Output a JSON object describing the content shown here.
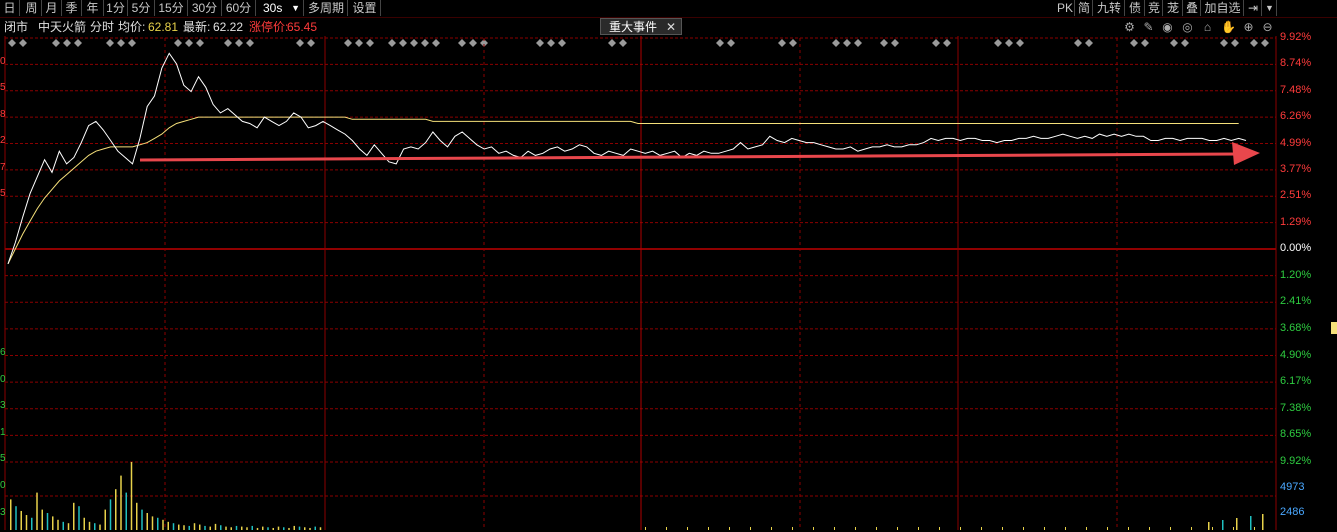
{
  "toolbar": {
    "periods": [
      "日",
      "周",
      "月",
      "季",
      "年",
      "1分",
      "5分",
      "15分",
      "30分",
      "60分"
    ],
    "interval": "30s",
    "multi_period": "多周期",
    "settings": "设置",
    "right_buttons": [
      "PK",
      "简",
      "九转",
      "债",
      "竞",
      "茏",
      "叠",
      "加自选"
    ]
  },
  "info": {
    "status": "闭市",
    "stock_name": "中天火箭",
    "mode": "分时",
    "avg_label": "均价:",
    "avg_value": "62.81",
    "latest_label": "最新:",
    "latest_value": "62.22",
    "limit_label": "涨停价:",
    "limit_value": "65.45",
    "event_tab": "重大事件"
  },
  "icons": [
    "settings-gear-icon",
    "brush-icon",
    "eye-icon",
    "eye-outline-icon",
    "basket-icon",
    "hand-icon",
    "zoom-in-icon",
    "zoom-out-icon"
  ],
  "axis_right": {
    "up": [
      "9.92%",
      "8.74%",
      "7.48%",
      "6.26%",
      "4.99%",
      "3.77%",
      "2.51%",
      "1.29%"
    ],
    "zero": "0.00%",
    "down": [
      "1.20%",
      "2.41%",
      "3.68%",
      "4.90%",
      "6.17%",
      "7.38%",
      "8.65%",
      "9.92%"
    ],
    "volume": [
      "4973",
      "2486"
    ]
  },
  "axis_left_partial": [
    "0",
    "5",
    "8",
    "2",
    "7",
    "5",
    "",
    "",
    "",
    "",
    "",
    "6",
    "0",
    "3",
    "1",
    "5",
    "0",
    "3"
  ],
  "colors": {
    "up": "#ff3b3b",
    "down": "#2ecc40",
    "zero": "#ffffff",
    "grid": "#8b0000",
    "price_line": "#ffffff",
    "avg_line": "#f5e07a",
    "arrow": "#e8474c",
    "volume_up": "#e8d24a",
    "volume_down": "#20c0c0"
  },
  "chart_data": {
    "type": "line",
    "y_unit": "percent change",
    "ylim": [
      -9.92,
      9.92
    ],
    "series": [
      {
        "values": [
          -0.7,
          0.3,
          1.5,
          2.6,
          3.4,
          4.2,
          3.6,
          4.6,
          4.0,
          4.3,
          5.0,
          5.8,
          6.0,
          5.6,
          5.1,
          4.6,
          4.3,
          4.0,
          5.2,
          6.7,
          7.2,
          8.5,
          9.2,
          8.7,
          7.7,
          7.4,
          8.1,
          7.6,
          6.8,
          6.4,
          6.6,
          6.3,
          6.0,
          5.9,
          5.7,
          6.2,
          6.0,
          5.8,
          6.0,
          6.4,
          6.2,
          5.7,
          5.8,
          6.0,
          5.8,
          5.6,
          5.4,
          5.1,
          4.7,
          4.4,
          4.9,
          4.5,
          4.1,
          4.0,
          4.7,
          4.8,
          4.7,
          5.0,
          5.5,
          5.1,
          4.8,
          5.3,
          5.5,
          5.2,
          4.9,
          4.7,
          4.8,
          4.5,
          4.6,
          4.4,
          4.3,
          4.6,
          4.4,
          4.5,
          4.7,
          4.8,
          4.6,
          4.7,
          4.9,
          4.8,
          4.5,
          4.4,
          4.6,
          4.5,
          4.4,
          4.7,
          4.6,
          4.5,
          4.6,
          4.4,
          4.5,
          4.6,
          4.3,
          4.5,
          4.4,
          4.6,
          4.5,
          4.5,
          4.6,
          4.7,
          5.0,
          4.7,
          4.8,
          4.9,
          5.3,
          5.1,
          5.0,
          5.2,
          5.1,
          5.0,
          5.0,
          4.9,
          4.8,
          4.7,
          4.7,
          4.8,
          4.6,
          4.7,
          4.8,
          4.8,
          4.9,
          4.8,
          4.8,
          4.9,
          4.9,
          5.0,
          5.2,
          5.1,
          5.2,
          5.2,
          5.1,
          5.2,
          5.2,
          5.1,
          5.1,
          5.0,
          5.1,
          5.1,
          5.2,
          5.2,
          5.3,
          5.2,
          5.2,
          5.3,
          5.4,
          5.3,
          5.2,
          5.3,
          5.2,
          5.4,
          5.3,
          5.4,
          5.3,
          5.4,
          5.3,
          5.3,
          5.1,
          5.1,
          5.2,
          5.2,
          5.1,
          5.2,
          5.2,
          5.2,
          5.1,
          5.1,
          5.2,
          5.1,
          5.2,
          5.1
        ]
      },
      {
        "values": [
          -0.7,
          0.0,
          0.7,
          1.3,
          1.9,
          2.4,
          2.8,
          3.2,
          3.5,
          3.8,
          4.1,
          4.4,
          4.6,
          4.7,
          4.8,
          4.8,
          4.8,
          4.8,
          4.9,
          5.0,
          5.2,
          5.4,
          5.7,
          5.9,
          6.0,
          6.1,
          6.2,
          6.2,
          6.2,
          6.2,
          6.2,
          6.2,
          6.2,
          6.2,
          6.2,
          6.2,
          6.2,
          6.2,
          6.2,
          6.2,
          6.2,
          6.2,
          6.2,
          6.2,
          6.2,
          6.2,
          6.2,
          6.1,
          6.1,
          6.1,
          6.1,
          6.1,
          6.1,
          6.1,
          6.1,
          6.1,
          6.1,
          6.1,
          6.0,
          6.0,
          6.0,
          6.0,
          6.0,
          6.0,
          6.0,
          6.0,
          6.0,
          6.0,
          6.0,
          6.0,
          6.0,
          6.0,
          6.0,
          6.0,
          6.0,
          6.0,
          6.0,
          6.0,
          6.0,
          6.0,
          6.0,
          6.0,
          6.0,
          6.0,
          6.0,
          6.0,
          5.9,
          5.9,
          5.9,
          5.9,
          5.9,
          5.9,
          5.9,
          5.9,
          5.9,
          5.9,
          5.9,
          5.9,
          5.9,
          5.9,
          5.9,
          5.9,
          5.9,
          5.9,
          5.9,
          5.9,
          5.9,
          5.9,
          5.9,
          5.9,
          5.9,
          5.9,
          5.9,
          5.9,
          5.9,
          5.9,
          5.9,
          5.9,
          5.9,
          5.9,
          5.9,
          5.9,
          5.9,
          5.9,
          5.9,
          5.9,
          5.9,
          5.9,
          5.9,
          5.9,
          5.9,
          5.9,
          5.9,
          5.9,
          5.9,
          5.9,
          5.9,
          5.9,
          5.9,
          5.9,
          5.9,
          5.9,
          5.9,
          5.9,
          5.9,
          5.9,
          5.9,
          5.9,
          5.9,
          5.9,
          5.9,
          5.9,
          5.9,
          5.9,
          5.9,
          5.9,
          5.9,
          5.9,
          5.9,
          5.9,
          5.9,
          5.9,
          5.9,
          5.9,
          5.9,
          5.9,
          5.9,
          5.9,
          5.9
        ]
      }
    ],
    "volume": [
      0.45,
      0.35,
      0.28,
      0.22,
      0.18,
      0.55,
      0.3,
      0.25,
      0.2,
      0.15,
      0.12,
      0.1,
      0.4,
      0.35,
      0.18,
      0.12,
      0.1,
      0.08,
      0.3,
      0.45,
      0.6,
      0.8,
      0.55,
      1.0,
      0.4,
      0.3,
      0.25,
      0.2,
      0.18,
      0.15,
      0.12,
      0.1,
      0.08,
      0.07,
      0.06,
      0.1,
      0.08,
      0.06,
      0.05,
      0.09,
      0.07,
      0.05,
      0.04,
      0.06,
      0.05,
      0.04,
      0.06,
      0.03,
      0.05,
      0.04,
      0.03,
      0.05,
      0.04,
      0.03,
      0.06,
      0.05,
      0.04,
      0.03,
      0.05,
      0.04
    ]
  }
}
